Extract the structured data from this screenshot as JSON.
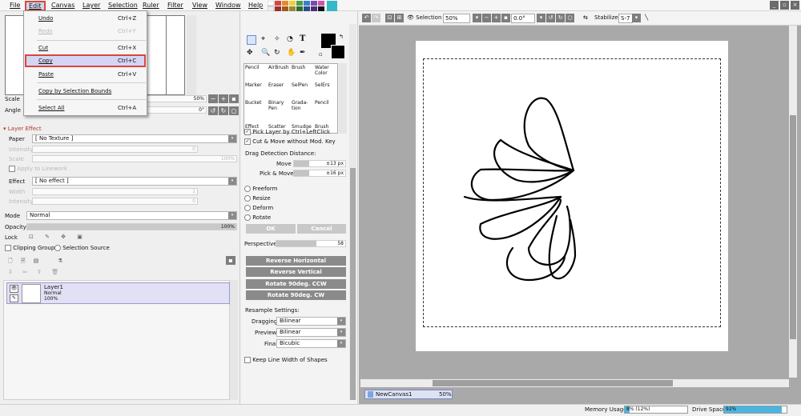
{
  "menubar": {
    "items": [
      "File",
      "Edit",
      "Canvas",
      "Layer",
      "Selection",
      "Ruler",
      "Filter",
      "View",
      "Window",
      "Help"
    ],
    "window_buttons": [
      "_",
      "▫",
      "×"
    ]
  },
  "edit_menu": {
    "items": [
      {
        "label": "Undo",
        "shortcut": "Ctrl+Z",
        "enabled": true
      },
      {
        "label": "Redo",
        "shortcut": "Ctrl+Y",
        "enabled": false
      },
      {
        "label": "Cut",
        "shortcut": "Ctrl+X",
        "enabled": true
      },
      {
        "label": "Copy",
        "shortcut": "Ctrl+C",
        "enabled": true,
        "highlighted": true
      },
      {
        "label": "Paste",
        "shortcut": "Ctrl+V",
        "enabled": true
      },
      {
        "label": "Copy by Selection Bounds",
        "shortcut": "",
        "enabled": true
      },
      {
        "label": "Select All",
        "shortcut": "Ctrl+A",
        "enabled": true
      }
    ]
  },
  "navigator": {
    "scale_label": "Scale",
    "scale_value": "50%",
    "angle_label": "Angle",
    "angle_value": "0°"
  },
  "layer_effect": {
    "header": "Layer Effect",
    "paper_label": "Paper",
    "paper_value": "[ No Texture ]",
    "intensity_label": "Intensity",
    "intensity_value": "0",
    "scale_label": "Scale",
    "scale_value": "100%",
    "apply_to_linework": "Apply to Linework",
    "effect_label": "Effect",
    "effect_value": "[ No effect ]",
    "width_label": "Width",
    "width_value": "1",
    "intensity2_label": "Intensity",
    "intensity2_value": "0"
  },
  "layer_props": {
    "mode_label": "Mode",
    "mode_value": "Normal",
    "opacity_label": "Opacity",
    "opacity_value": "100%",
    "lock_label": "Lock",
    "clipping_group": "Clipping Group",
    "selection_source": "Selection Source"
  },
  "layers": [
    {
      "name": "Layer1",
      "mode": "Normal",
      "opacity": "100%"
    }
  ],
  "tools": {
    "grid": [
      "Pencil",
      "AirBrush",
      "Brush",
      "Water Color",
      "Marker",
      "Eraser",
      "SelPen",
      "SelErs",
      "Bucket",
      "Binary Pen",
      "Grada-tion",
      "Pencil",
      "Effect",
      "Scatter",
      "Smudge",
      "Brush"
    ]
  },
  "tool_options": {
    "pick_layer": "Pick Layer by Ctrl+LeftClick",
    "cut_move": "Cut & Move without Mod. Key",
    "drag_detection": "Drag Detection Distance:",
    "move_label": "Move",
    "move_value": "±13 px",
    "pickmove_label": "Pick & Move",
    "pickmove_value": "±16 px",
    "freeform": "Freeform",
    "resize": "Resize",
    "deform": "Deform",
    "rotate": "Rotate",
    "ok": "OK",
    "cancel": "Cancel",
    "perspective_label": "Perspective",
    "perspective_value": "58",
    "reverse_h": "Reverse Horizontal",
    "reverse_v": "Reverse Vertical",
    "rotate_ccw": "Rotate 90deg. CCW",
    "rotate_cw": "Rotate 90deg. CW",
    "resample": "Resample Settings:",
    "dragging_label": "Dragging",
    "dragging_value": "Bilinear",
    "preview_label": "Preview",
    "preview_value": "Bilinear",
    "final_label": "Final",
    "final_value": "Bicubic",
    "keep_line": "Keep Line Width of Shapes"
  },
  "canvas_toolbar": {
    "selection_label": "Selection",
    "zoom_value": "50%",
    "angle_value": "0.0°",
    "stabilizer_label": "Stabilizer",
    "stabilizer_value": "S-7"
  },
  "canvas_tab": {
    "name": "NewCanvas1",
    "zoom": "50%"
  },
  "status": {
    "memory_label": "Memory Usage",
    "memory_value": "8% (12%)",
    "memory_fill": 0.08,
    "drive_label": "Drive Space",
    "drive_value": "92%",
    "drive_fill": 0.92
  },
  "colors": {
    "accent_red": "#d9463f",
    "highlight": "#d5d5f3",
    "canvas_bg": "#a9a9a9"
  }
}
